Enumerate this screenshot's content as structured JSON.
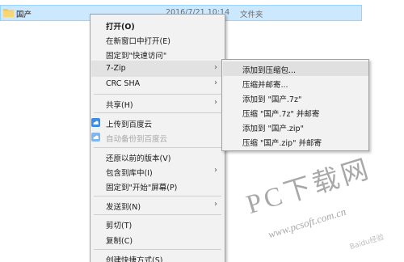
{
  "explorer": {
    "file_name": "国产",
    "file_date": "2016/7/21 10:14",
    "file_type": "文件夹"
  },
  "context_menu": {
    "items": [
      {
        "label": "打开(O)",
        "bold": true
      },
      {
        "label": "在新窗口中打开(E)"
      },
      {
        "label": "固定到\"快速访问\""
      },
      {
        "label": "7-Zip",
        "submenu": true,
        "highlighted": true
      },
      {
        "label": "CRC SHA",
        "submenu": true
      },
      {
        "label": "共享(H)",
        "submenu": true
      },
      {
        "label": "上传到百度云",
        "icon": "baidu-cloud-icon"
      },
      {
        "label": "自动备份到百度云",
        "icon": "baidu-cloud-icon",
        "disabled": true
      },
      {
        "label": "还原以前的版本(V)"
      },
      {
        "label": "包含到库中(I)",
        "submenu": true
      },
      {
        "label": "固定到\"开始\"屏幕(P)"
      },
      {
        "label": "发送到(N)",
        "submenu": true
      },
      {
        "label": "剪切(T)"
      },
      {
        "label": "复制(C)"
      },
      {
        "label": "创建快捷方式(S)"
      }
    ]
  },
  "zip_submenu": {
    "items": [
      {
        "label": "添加到压缩包...",
        "highlighted": true
      },
      {
        "label": "压缩并邮寄..."
      },
      {
        "label": "添加到 \"国产.7z\""
      },
      {
        "label": "压缩 \"国产.7z\" 并邮寄"
      },
      {
        "label": "添加到 \"国产.zip\""
      },
      {
        "label": "压缩 \"国产.zip\" 并邮寄"
      }
    ]
  },
  "watermark": {
    "title": "PC下载网",
    "url": "www.pcsoft.com.cn",
    "logo": "Baidu经验"
  },
  "colors": {
    "selection": "#cce8ff",
    "menu_bg": "#f2f2f2",
    "menu_hover": "#e2e2e2",
    "folder": "#f4c652",
    "baidu_blue": "#3a8ee6"
  }
}
